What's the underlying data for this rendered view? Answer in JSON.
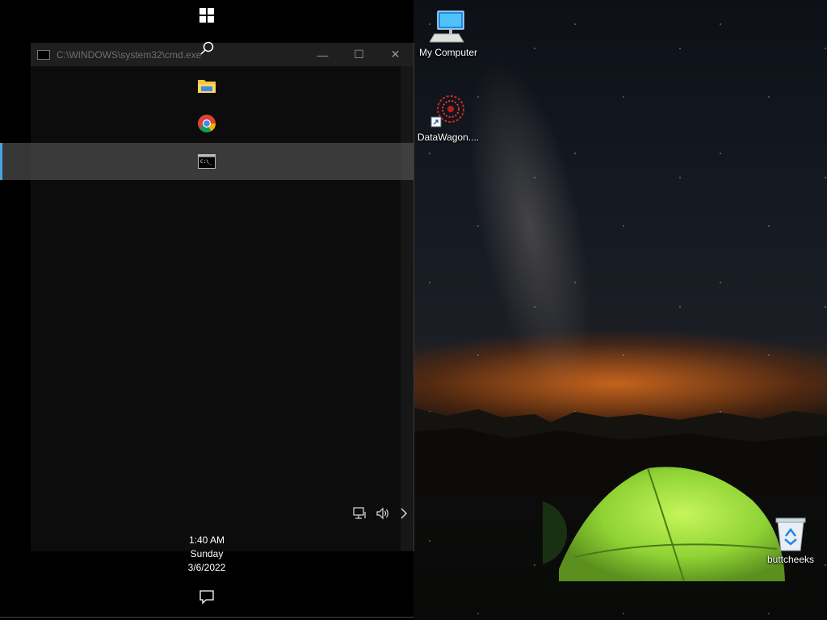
{
  "cmd_window": {
    "title": "C:\\WINDOWS\\system32\\cmd.exe",
    "minimize": "—",
    "maximize": "☐",
    "close": "✕"
  },
  "taskbar": {
    "items": [
      {
        "name": "start-button",
        "icon": "windows-logo-icon"
      },
      {
        "name": "search-button",
        "icon": "search-icon"
      },
      {
        "name": "file-explorer",
        "icon": "folder-icon"
      },
      {
        "name": "chrome",
        "icon": "chrome-icon"
      },
      {
        "name": "command-prompt",
        "icon": "cmd-icon",
        "active": true
      }
    ],
    "tray": {
      "network_icon": "network-icon",
      "volume_icon": "volume-icon",
      "expand_icon": "chevron-right-icon"
    },
    "clock": {
      "time": "1:40 AM",
      "day": "Sunday",
      "date": "3/6/2022"
    },
    "notification_icon": "action-center-icon"
  },
  "desktop": {
    "icons": [
      {
        "label": "My Computer",
        "icon": "computer-icon"
      },
      {
        "label": "DataWagon....",
        "icon": "datawagon-shortcut-icon"
      },
      {
        "label": "buttcheeks",
        "icon": "recycle-bin-icon"
      }
    ]
  },
  "colors": {
    "accent": "#4aa3df",
    "taskbar": "#000000",
    "tent": "#9be33a"
  }
}
